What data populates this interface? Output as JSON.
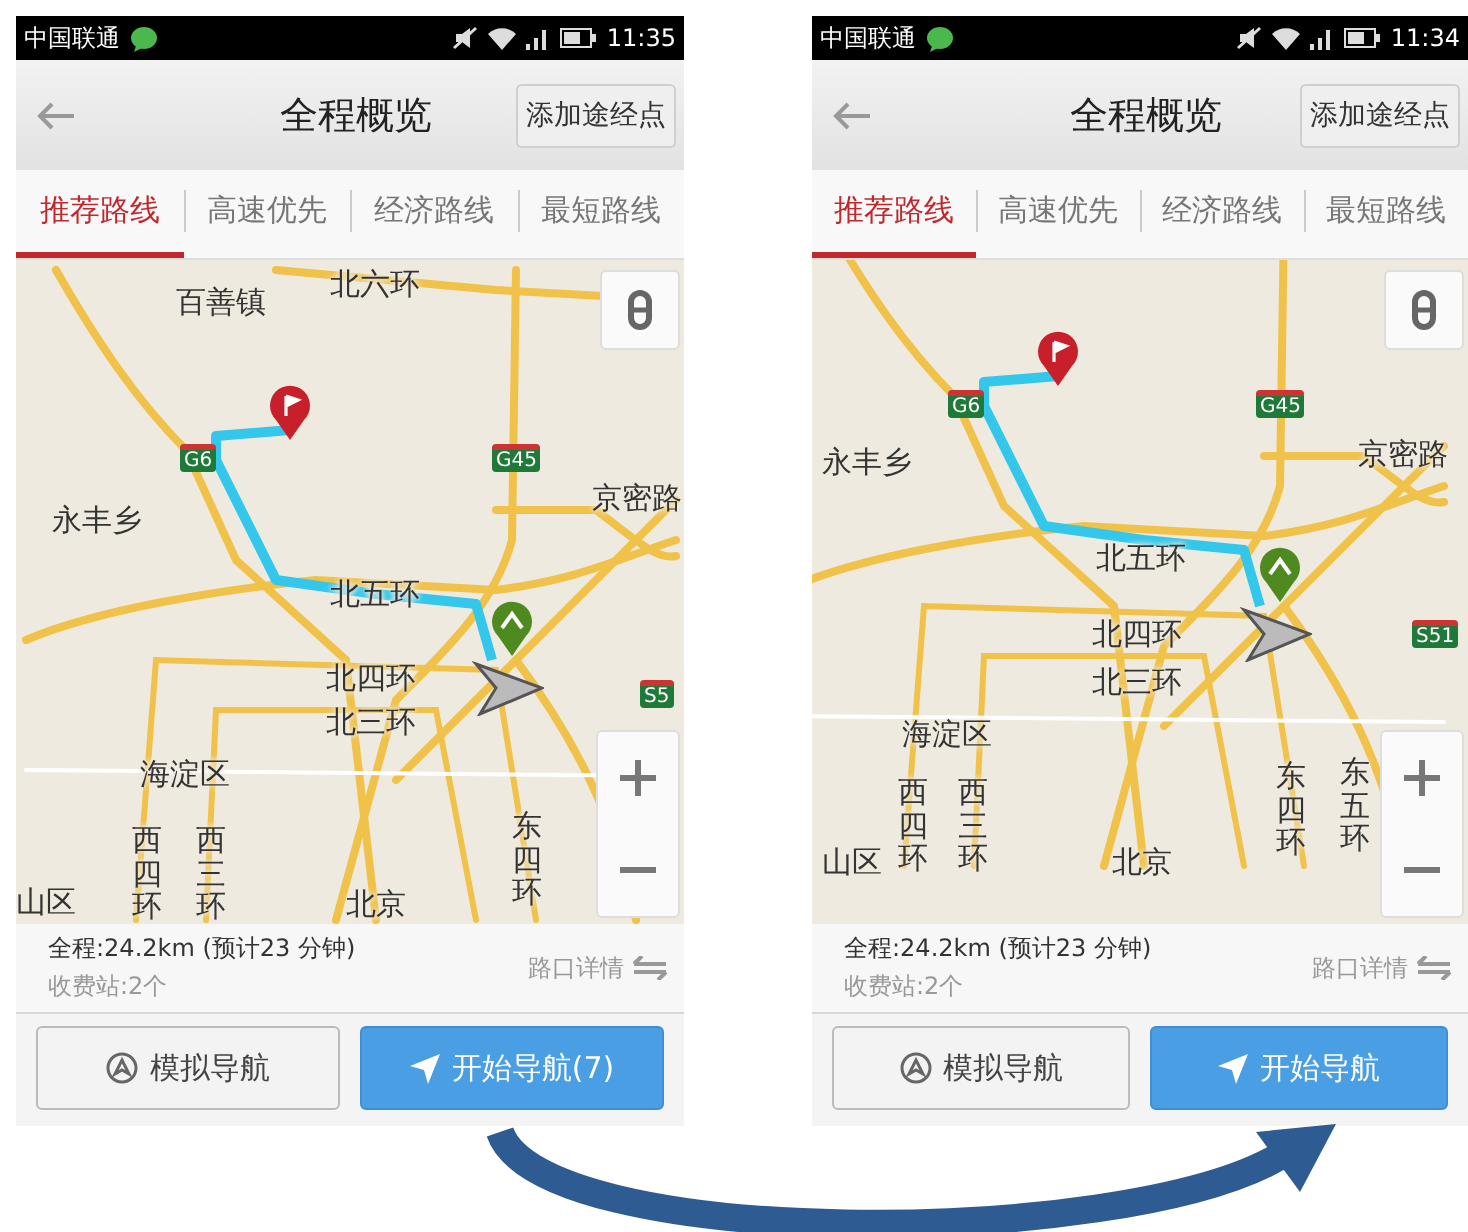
{
  "phones": [
    {
      "status_bar": {
        "carrier": "中国联通",
        "time": "11:35"
      },
      "header": {
        "title": "全程概览",
        "action": "添加途经点"
      },
      "tabs": [
        {
          "label": "推荐路线",
          "selected": true
        },
        {
          "label": "高速优先",
          "selected": false
        },
        {
          "label": "经济路线",
          "selected": false
        },
        {
          "label": "最短路线",
          "selected": false
        }
      ],
      "map": {
        "labels": [
          {
            "text": "百善镇",
            "kind": "h"
          },
          {
            "text": "北六环",
            "kind": "h"
          },
          {
            "text": "永丰乡",
            "kind": "h"
          },
          {
            "text": "京密路",
            "kind": "h"
          },
          {
            "text": "北五环",
            "kind": "h"
          },
          {
            "text": "北四环",
            "kind": "h"
          },
          {
            "text": "北三环",
            "kind": "h"
          },
          {
            "text": "海淀区",
            "kind": "h"
          },
          {
            "text": "山区",
            "kind": "h"
          },
          {
            "text": "西四环",
            "kind": "v"
          },
          {
            "text": "西三环",
            "kind": "v"
          },
          {
            "text": "北京",
            "kind": "h"
          },
          {
            "text": "东四环",
            "kind": "v"
          }
        ],
        "shields": [
          "G6",
          "G45",
          "S5"
        ]
      },
      "summary": {
        "distance": "全程:24.2km (预计23 分钟)",
        "tolls": "收费站:2个",
        "details": "路口详情"
      },
      "buttons": {
        "simulate": "模拟导航",
        "start": "开始导航(7)"
      }
    },
    {
      "status_bar": {
        "carrier": "中国联通",
        "time": "11:34"
      },
      "header": {
        "title": "全程概览",
        "action": "添加途经点"
      },
      "tabs": [
        {
          "label": "推荐路线",
          "selected": true
        },
        {
          "label": "高速优先",
          "selected": false
        },
        {
          "label": "经济路线",
          "selected": false
        },
        {
          "label": "最短路线",
          "selected": false
        }
      ],
      "map": {
        "labels": [
          {
            "text": "永丰乡",
            "kind": "h"
          },
          {
            "text": "京密路",
            "kind": "h"
          },
          {
            "text": "北五环",
            "kind": "h"
          },
          {
            "text": "北四环",
            "kind": "h"
          },
          {
            "text": "北三环",
            "kind": "h"
          },
          {
            "text": "海淀区",
            "kind": "h"
          },
          {
            "text": "山区",
            "kind": "h"
          },
          {
            "text": "西四环",
            "kind": "v"
          },
          {
            "text": "西三环",
            "kind": "v"
          },
          {
            "text": "北京",
            "kind": "h"
          },
          {
            "text": "东四环",
            "kind": "v"
          },
          {
            "text": "东五环",
            "kind": "v"
          }
        ],
        "shields": [
          "G6",
          "G45",
          "S51"
        ]
      },
      "summary": {
        "distance": "全程:24.2km (预计23 分钟)",
        "tolls": "收费站:2个",
        "details": "路口详情"
      },
      "buttons": {
        "simulate": "模拟导航",
        "start": "开始导航"
      }
    }
  ]
}
